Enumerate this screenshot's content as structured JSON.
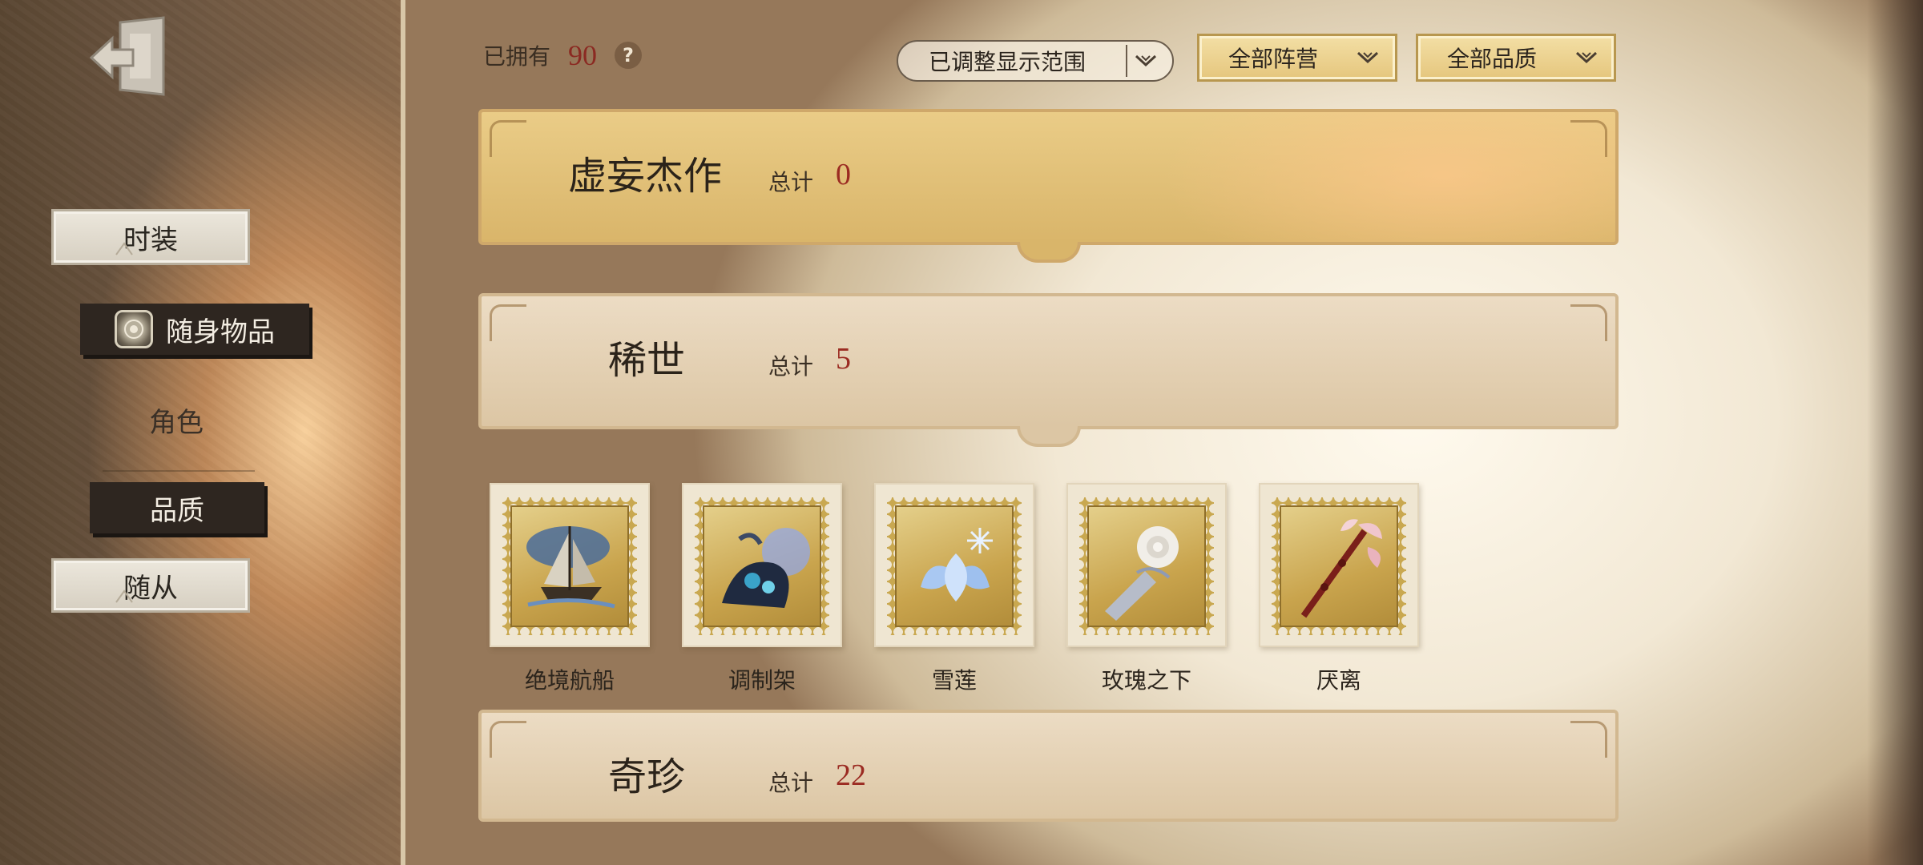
{
  "sidebar": {
    "items": [
      {
        "label": "时装"
      },
      {
        "label": "随身物品"
      },
      {
        "label": "角色"
      },
      {
        "label": "品质"
      },
      {
        "label": "随从"
      }
    ]
  },
  "header": {
    "owned_label": "已拥有",
    "owned_count": "90",
    "help_symbol": "?",
    "range_filter": "已调整显示范围",
    "camp_filter": "全部阵营",
    "quality_filter": "全部品质"
  },
  "sections": [
    {
      "title": "虚妄杰作",
      "total_label": "总计",
      "total": "0"
    },
    {
      "title": "稀世",
      "total_label": "总计",
      "total": "5"
    },
    {
      "title": "奇珍",
      "total_label": "总计",
      "total": "22"
    }
  ],
  "items": [
    {
      "name": "绝境航船",
      "icon": "ship-icon"
    },
    {
      "name": "调制架",
      "icon": "potion-rack-icon"
    },
    {
      "name": "雪莲",
      "icon": "snow-lotus-icon"
    },
    {
      "name": "玫瑰之下",
      "icon": "rose-icon"
    },
    {
      "name": "厌离",
      "icon": "thorn-staff-icon"
    }
  ],
  "colors": {
    "accent_red": "#9b2b22",
    "gold_banner": "#d9b56a",
    "dark_chip": "#2e2620"
  }
}
